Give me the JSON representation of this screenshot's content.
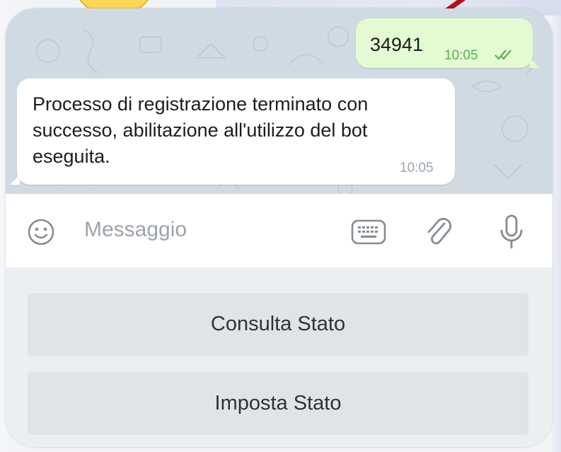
{
  "messages": {
    "outgoing": {
      "text": "34941",
      "time": "10:05",
      "status_icon": "double-check-icon"
    },
    "incoming": {
      "text": "Processo di registrazione terminato con successo, abilitazione all'utilizzo del bot eseguita.",
      "time": "10:05"
    }
  },
  "input_bar": {
    "placeholder": "Messaggio",
    "icons": [
      "emoji-icon",
      "keyboard-icon",
      "attach-icon",
      "microphone-icon"
    ]
  },
  "bot_keyboard": {
    "buttons": [
      {
        "label": "Consulta Stato"
      },
      {
        "label": "Imposta Stato"
      }
    ]
  },
  "colors": {
    "chat_background": "#cfdae3",
    "outgoing_bubble": "#e3fbd3",
    "incoming_bubble": "#ffffff",
    "time_outgoing": "#5ead4f",
    "keyboard_button": "#e0e4e8"
  }
}
